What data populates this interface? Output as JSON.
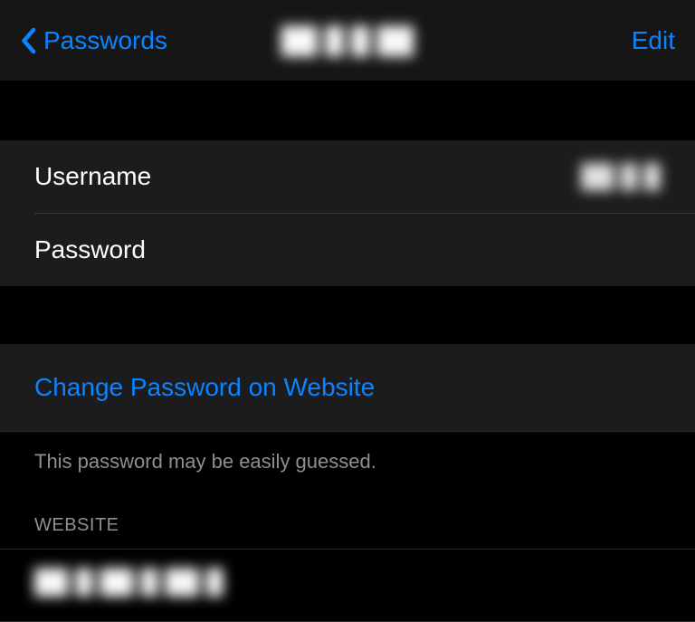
{
  "nav": {
    "back_label": "Passwords",
    "title_redacted": "██ █ █ ██",
    "edit_label": "Edit"
  },
  "credentials": {
    "username_label": "Username",
    "username_value_redacted": "██ █ █",
    "password_label": "Password",
    "password_value_redacted": ""
  },
  "action": {
    "change_password_label": "Change Password on Website"
  },
  "hint": {
    "text": "This password may be easily guessed."
  },
  "website": {
    "header": "WEBSITE",
    "value_redacted": "██ █ ██ █ ██ █"
  }
}
